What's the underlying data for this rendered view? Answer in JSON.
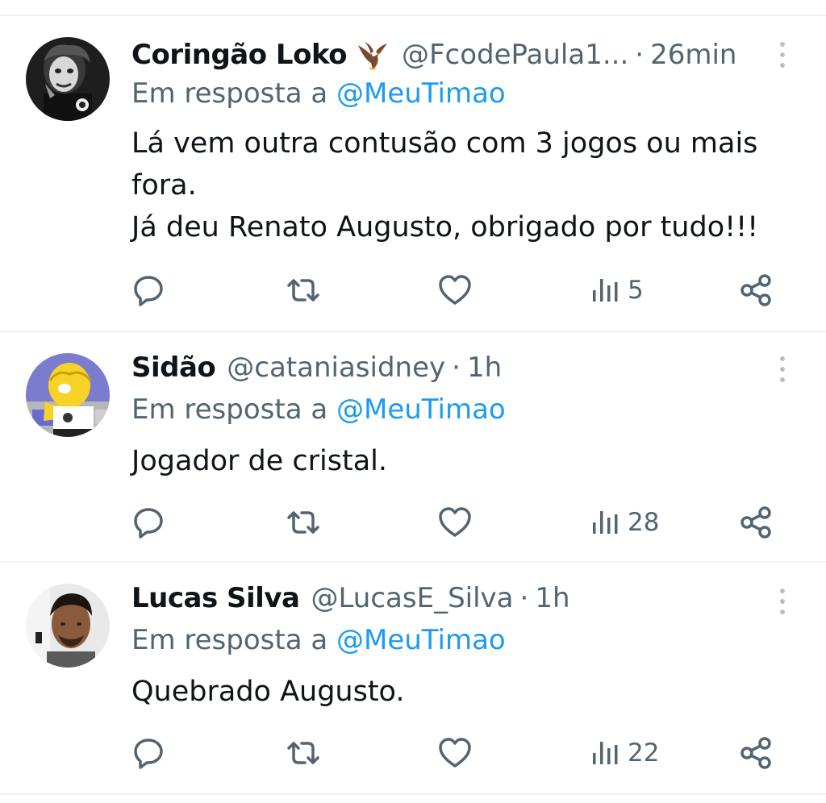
{
  "tweets": [
    {
      "name": "Coringão Loko",
      "badge_icon": "eagle-emoji-icon",
      "handle": "@FcodePaula1...",
      "separator": "·",
      "time": "26min",
      "replying_prefix": "Em resposta a ",
      "replying_to": "@MeuTimao",
      "lines": [
        "Lá vem outra contusão com 3 jogos ou mais",
        "fora.",
        "Já deu Renato Augusto, obrigado por tudo!!!"
      ],
      "views": "5"
    },
    {
      "name": "Sidão",
      "handle": "@cataniasidney",
      "separator": "·",
      "time": "1h",
      "replying_prefix": "Em resposta a ",
      "replying_to": "@MeuTimao",
      "lines": [
        "Jogador de cristal."
      ],
      "views": "28"
    },
    {
      "name": "Lucas Silva",
      "handle": "@LucasE_Silva",
      "separator": "·",
      "time": "1h",
      "replying_prefix": "Em resposta a ",
      "replying_to": "@MeuTimao",
      "lines": [
        "Quebrado Augusto."
      ],
      "views": "22"
    }
  ],
  "colors": {
    "text": "#0f1419",
    "secondary": "#536471",
    "link": "#1d9bf0",
    "divider": "#eff3f4"
  }
}
